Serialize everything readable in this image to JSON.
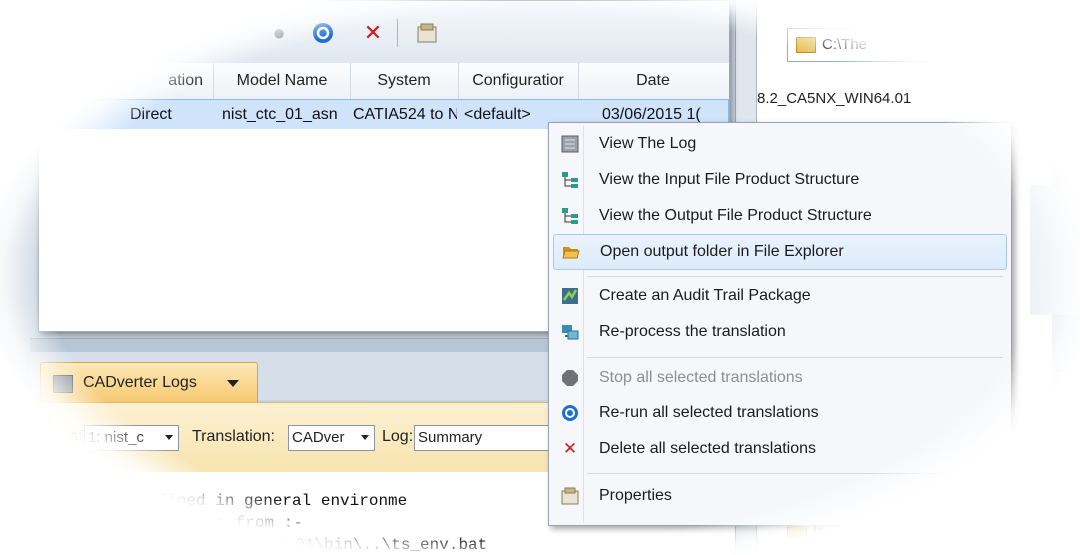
{
  "toolbar": {
    "icons": [
      "rerun-icon",
      "delete-icon",
      "properties-icon"
    ]
  },
  "table": {
    "columns": [
      "ation",
      "Model Name",
      "System",
      "Configuratior",
      "Date"
    ],
    "rows": [
      [
        "Direct",
        "nist_ctc_01_asn",
        "CATIA524 to N",
        "<default>",
        "03/06/2015 1("
      ]
    ]
  },
  "right_panel": {
    "path": "C:\\The",
    "entry_text": "8.2_CA5NX_WIN64.01",
    "bottom_text": "I-"
  },
  "logs_tab": {
    "label": "CADverter Logs"
  },
  "filter_bar": {
    "model_prefix": "s:",
    "model_value": "1: nist_c",
    "translation_label": "Translation:",
    "translation_value": "CADver",
    "log_label": "Log:",
    "log_value": "Summary"
  },
  "log_lines": [
    "ST  defined in general environme",
    "   ronment from :-",
    "        N64.01\\bin\\..\\ts_env.bat"
  ],
  "context_menu": {
    "items": [
      {
        "label": "View The Log",
        "icon": "log-icon",
        "disabled": false,
        "highlighted": false
      },
      {
        "label": "View the Input File Product Structure",
        "icon": "tree-structure-icon",
        "disabled": false,
        "highlighted": false
      },
      {
        "label": "View the Output File Product Structure",
        "icon": "tree-structure-icon",
        "disabled": false,
        "highlighted": false
      },
      {
        "label": "Open output folder in File Explorer",
        "icon": "open-folder-icon",
        "disabled": false,
        "highlighted": true
      },
      {
        "label": "Create an Audit Trail Package",
        "icon": "audit-package-icon",
        "disabled": false,
        "highlighted": false
      },
      {
        "label": "Re-process the translation",
        "icon": "reprocess-icon",
        "disabled": false,
        "highlighted": false
      },
      {
        "label": "Stop all selected translations",
        "icon": "stop-icon",
        "disabled": true,
        "highlighted": false
      },
      {
        "label": "Re-run all selected translations",
        "icon": "rerun-icon",
        "disabled": false,
        "highlighted": false
      },
      {
        "label": "Delete all selected translations",
        "icon": "delete-icon",
        "disabled": false,
        "highlighted": false
      },
      {
        "label": "Properties",
        "icon": "properties-icon",
        "disabled": false,
        "highlighted": false
      }
    ]
  },
  "colors": {
    "selection": "#cfe3fb",
    "menu_highlight": "#dcebfc",
    "tab_accent": "#f6c870",
    "delete_red": "#d11a1a",
    "rerun_blue": "#1f6fd1"
  }
}
